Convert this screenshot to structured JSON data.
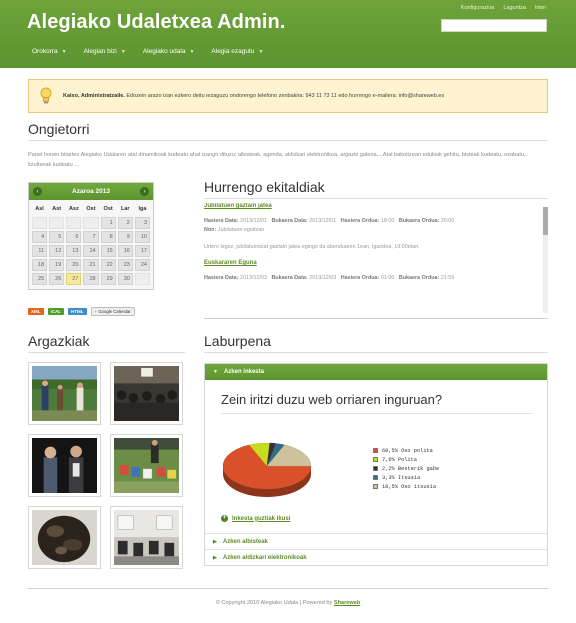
{
  "header": {
    "site_title": "Alegiako Udaletxea Admin.",
    "toplinks": [
      "Konfigurazioa",
      "Laguntza",
      "Irten"
    ],
    "search_placeholder": ""
  },
  "nav": {
    "items": [
      {
        "label": "Orokorra",
        "icon": "chevron-down-icon"
      },
      {
        "label": "Alegian bizi",
        "icon": "chevron-down-icon"
      },
      {
        "label": "Alegiako udala",
        "icon": "chevron-down-icon"
      },
      {
        "label": "Alegia ezagutu",
        "icon": "chevron-down-icon"
      }
    ]
  },
  "notice": {
    "icon": "lightbulb-icon",
    "greeting": "Kaixo, Administratzaile.",
    "text": " Edozein arazo izan ezkero deitu iezaguzu ondorengo telefono zenbakira: 943 11 73 11 edo hurrengo e-mailera: info@shareweb.es"
  },
  "welcome": {
    "title": "Ongietorri",
    "text": "Panel honen bitartez Alegiako Udalaren atal dinamikoak kudeatu ahal izango dituzu; albisteak, agenda, aldizkari elektronikoa, argazki galeria,...Atal bakoitzean edukiak gehitu, bisteak kudeatu, ezabatu, itzultzeak kudeatu ..."
  },
  "calendar": {
    "month": "Azaroa 2013",
    "prev_icon": "chevron-left-icon",
    "next_icon": "chevron-right-icon",
    "weekdays": [
      "Asl",
      "Ast",
      "Asz",
      "Ost",
      "Ost",
      "Lar",
      "Iga"
    ],
    "days": [
      "",
      "",
      "",
      "",
      "1",
      "2",
      "3",
      "4",
      "5",
      "6",
      "7",
      "8",
      "9",
      "10",
      "11",
      "12",
      "13",
      "14",
      "15",
      "16",
      "17",
      "18",
      "19",
      "20",
      "21",
      "22",
      "23",
      "24",
      "25",
      "26",
      "27",
      "28",
      "29",
      "30",
      ""
    ],
    "today": "27",
    "feeds": [
      {
        "label": "XML",
        "color": "#e2641a"
      },
      {
        "label": "iCAL",
        "color": "#4f9b28"
      },
      {
        "label": "HTML",
        "color": "#3e8dc8"
      }
    ],
    "gcal_label": "Google Calendar"
  },
  "events": {
    "title": "Hurrengo ekitaldiak",
    "items": [
      {
        "title": "Jubilatuen gaztain jatea",
        "start_label": "Hasiera Data:",
        "start": "2013/12/01",
        "end_label": "Bukaera Data:",
        "end": "2013/12/01",
        "start_time_label": "Hasiera Ordua:",
        "start_time": "18:00",
        "end_time_label": "Bukaera Ordua:",
        "end_time": "20:00",
        "org_label": "Non:",
        "org": "Jubilatuen egoitzan",
        "desc": "Urtero legez, jubilatuentzat gaztain jatea egingo da abenduaren 1ean, igandea, 19:00etan."
      },
      {
        "title": "Euskararen Eguna",
        "start_label": "Hasiera Data:",
        "start": "2013/12/03",
        "end_label": "Bukaera Data:",
        "end": "2013/12/03",
        "start_time_label": "Hasiera Ordua:",
        "start_time": "01:00",
        "end_time_label": "Bukaera Ordua:",
        "end_time": "21:59"
      }
    ]
  },
  "photos": {
    "title": "Argazkiak",
    "items": [
      {
        "name": "photo-people-outdoors"
      },
      {
        "name": "photo-meeting-room"
      },
      {
        "name": "photo-two-men-talking"
      },
      {
        "name": "photo-children-group"
      },
      {
        "name": "photo-rock-closeup"
      },
      {
        "name": "photo-classroom-chairs"
      }
    ]
  },
  "summary": {
    "title": "Laburpena",
    "active_section": "Azken inkesta",
    "poll_title": "Zein iritzi duzu web orriaren inguruan?",
    "poll_link": "Inkesta guztiak ikusi",
    "closed_sections": [
      "Azken albisteak",
      "Azken aldizkari elektronikoak"
    ]
  },
  "chart_data": {
    "type": "pie",
    "categories": [
      "Oso polita",
      "Polita",
      "Besterik gabe",
      "Itsusia",
      "Oso itsusia"
    ],
    "values": [
      68.5,
      7.6,
      2.2,
      3.3,
      18.5
    ],
    "labels": [
      "68,5% Oso polita",
      "7,6% Polita",
      "2,2% Besterik gabe",
      "3,3% Itsusia",
      "18,5% Oso itsusia"
    ],
    "colors": [
      "#d9502a",
      "#c7dc1e",
      "#3c2a38",
      "#2f6c86",
      "#cdc29b"
    ]
  },
  "footer": {
    "text": "© Copyright 2010 Alegiako Udala | Powered by ",
    "link": "Shareweb"
  }
}
